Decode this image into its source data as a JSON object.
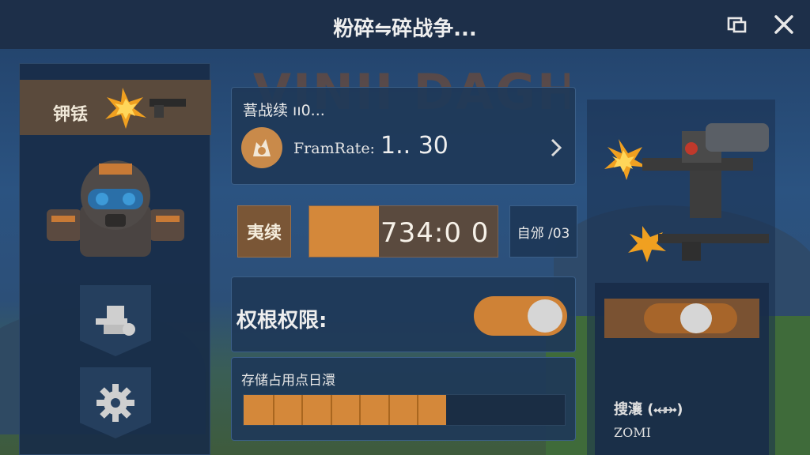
{
  "window": {
    "title": "粉碎⇋碎战争...",
    "restore_icon": "restore-window-icon",
    "close_icon": "close-icon"
  },
  "scene": {
    "bg_title": "VINII DAGHT"
  },
  "left_panel": {
    "banner_text": "钾铥",
    "avatar_icon": "helmet-character-icon",
    "buttons": [
      {
        "icon": "cannon-icon"
      },
      {
        "icon": "gear-icon"
      }
    ]
  },
  "fps_card": {
    "label": "䓊战续 ıı0...",
    "row_label": "FramRate:",
    "row_value": "1.. 30",
    "icon": "fps-emblem-icon"
  },
  "quality": {
    "label": "夷续",
    "value": "734:0  0",
    "fill_fraction": 0.37,
    "side_text": "自邠 /03"
  },
  "permission": {
    "label": "权根权限:",
    "enabled": true
  },
  "storage": {
    "label": "存储占用点日澴",
    "fill_fraction": 0.63
  },
  "right_panel": {
    "toggle_enabled": true,
    "label": "搜瀼 (⤟⤠)",
    "value": "ZOMI"
  },
  "colors": {
    "accent": "#d4883a",
    "panel": "#1e3858",
    "titlebar": "#1d2f49"
  }
}
